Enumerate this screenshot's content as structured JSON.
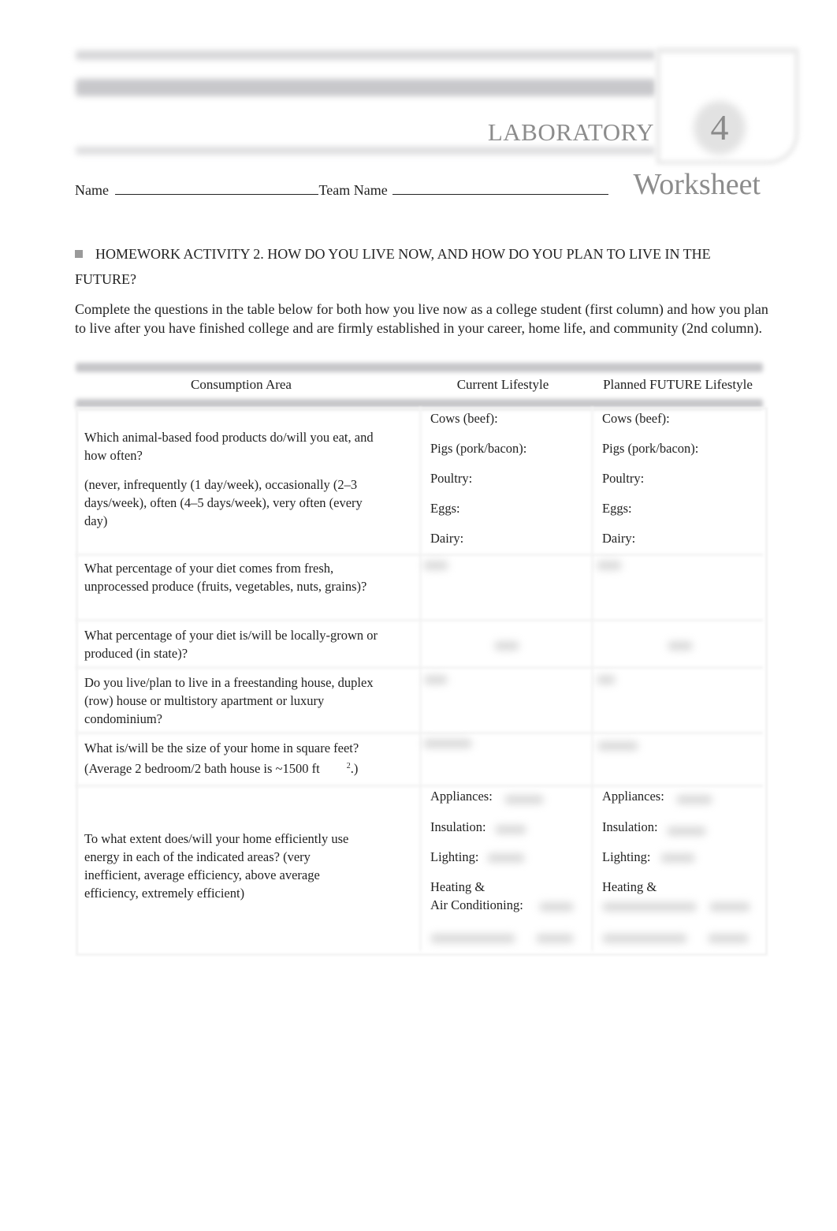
{
  "header": {
    "laboratory_label": "LABORATORY",
    "chapter_number": "4",
    "worksheet_label": "Worksheet",
    "name_label": "Name",
    "team_name_label": "Team Name"
  },
  "activity": {
    "bullet_icon": "square-bullet-icon",
    "title": "HOMEWORK ACTIVITY 2. HOW DO YOU LIVE NOW, AND HOW DO YOU PLAN TO LIVE IN THE FUTURE?",
    "instructions": "Complete the questions in the table below for both how you live now as a college student (first column) and how you plan to live after you have finished college and are firmly established in your career, home life, and community (2nd column)."
  },
  "table": {
    "columns": [
      "Consumption Area",
      "Current Lifestyle",
      "Planned FUTURE Lifestyle"
    ],
    "rows": [
      {
        "question": "Which animal-based food products do/will you eat, and how often?",
        "note": "(never, infrequently (1 day/week), occasionally (2–3 days/week), often (4–5 days/week), very often (every day)",
        "current_labels": [
          "Cows (beef):",
          "Pigs (pork/bacon):",
          "Poultry:",
          "Eggs:",
          "Dairy:"
        ],
        "future_labels": [
          "Cows (beef):",
          "Pigs (pork/bacon):",
          "Poultry:",
          "Eggs:",
          "Dairy:"
        ]
      },
      {
        "question": "What percentage of your diet comes from fresh, unprocessed produce (fruits, vegetables, nuts, grains)?"
      },
      {
        "question": "What percentage of your diet is/will be locally-grown or produced (in state)?"
      },
      {
        "question": "Do you live/plan to live in a freestanding house, duplex (row) house or multistory apartment or luxury condominium?"
      },
      {
        "question": "What is/will be the size of your home in square feet? (Average 2 bedroom/2 bath house is ~1500 ft",
        "sup": "2",
        "suffix": ".)"
      },
      {
        "question": "To what extent does/will your home efficiently use energy in each of the indicated areas? (very inefficient, average efficiency, above average efficiency, extremely efficient)",
        "current_labels": [
          "Appliances:",
          "Insulation:",
          "Lighting:",
          "Heating &",
          "Air Conditioning:"
        ],
        "future_labels": [
          "Appliances:",
          "Insulation:",
          "Lighting:",
          "Heating &"
        ]
      }
    ]
  }
}
